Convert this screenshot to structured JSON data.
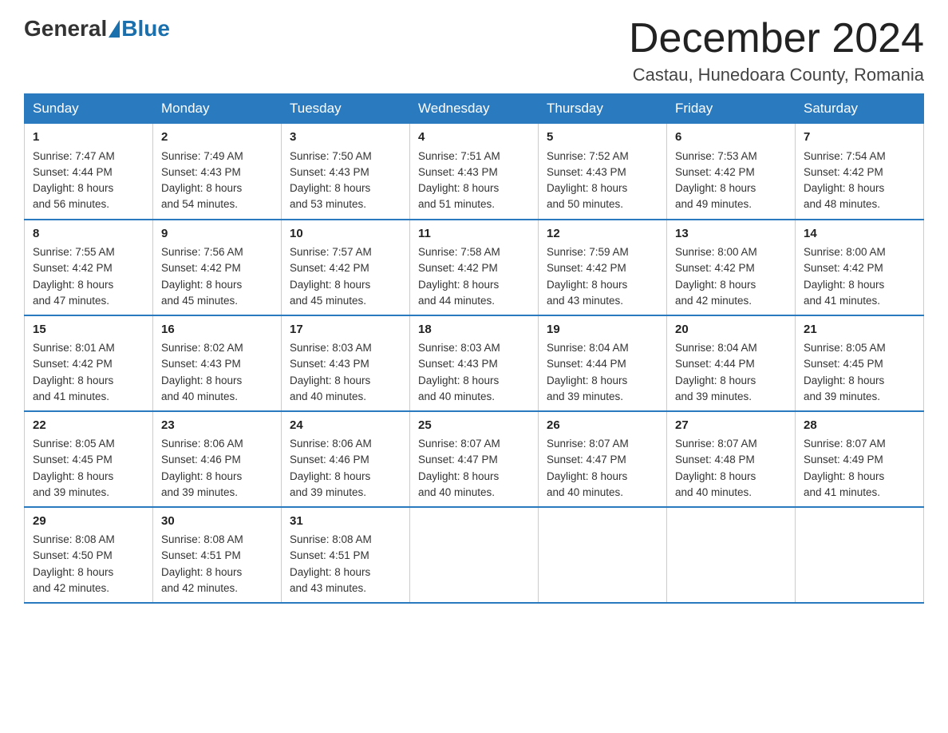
{
  "logo": {
    "general": "General",
    "blue": "Blue"
  },
  "title": "December 2024",
  "location": "Castau, Hunedoara County, Romania",
  "weekdays": [
    "Sunday",
    "Monday",
    "Tuesday",
    "Wednesday",
    "Thursday",
    "Friday",
    "Saturday"
  ],
  "weeks": [
    [
      {
        "day": "1",
        "sunrise": "7:47 AM",
        "sunset": "4:44 PM",
        "daylight": "8 hours and 56 minutes."
      },
      {
        "day": "2",
        "sunrise": "7:49 AM",
        "sunset": "4:43 PM",
        "daylight": "8 hours and 54 minutes."
      },
      {
        "day": "3",
        "sunrise": "7:50 AM",
        "sunset": "4:43 PM",
        "daylight": "8 hours and 53 minutes."
      },
      {
        "day": "4",
        "sunrise": "7:51 AM",
        "sunset": "4:43 PM",
        "daylight": "8 hours and 51 minutes."
      },
      {
        "day": "5",
        "sunrise": "7:52 AM",
        "sunset": "4:43 PM",
        "daylight": "8 hours and 50 minutes."
      },
      {
        "day": "6",
        "sunrise": "7:53 AM",
        "sunset": "4:42 PM",
        "daylight": "8 hours and 49 minutes."
      },
      {
        "day": "7",
        "sunrise": "7:54 AM",
        "sunset": "4:42 PM",
        "daylight": "8 hours and 48 minutes."
      }
    ],
    [
      {
        "day": "8",
        "sunrise": "7:55 AM",
        "sunset": "4:42 PM",
        "daylight": "8 hours and 47 minutes."
      },
      {
        "day": "9",
        "sunrise": "7:56 AM",
        "sunset": "4:42 PM",
        "daylight": "8 hours and 45 minutes."
      },
      {
        "day": "10",
        "sunrise": "7:57 AM",
        "sunset": "4:42 PM",
        "daylight": "8 hours and 45 minutes."
      },
      {
        "day": "11",
        "sunrise": "7:58 AM",
        "sunset": "4:42 PM",
        "daylight": "8 hours and 44 minutes."
      },
      {
        "day": "12",
        "sunrise": "7:59 AM",
        "sunset": "4:42 PM",
        "daylight": "8 hours and 43 minutes."
      },
      {
        "day": "13",
        "sunrise": "8:00 AM",
        "sunset": "4:42 PM",
        "daylight": "8 hours and 42 minutes."
      },
      {
        "day": "14",
        "sunrise": "8:00 AM",
        "sunset": "4:42 PM",
        "daylight": "8 hours and 41 minutes."
      }
    ],
    [
      {
        "day": "15",
        "sunrise": "8:01 AM",
        "sunset": "4:42 PM",
        "daylight": "8 hours and 41 minutes."
      },
      {
        "day": "16",
        "sunrise": "8:02 AM",
        "sunset": "4:43 PM",
        "daylight": "8 hours and 40 minutes."
      },
      {
        "day": "17",
        "sunrise": "8:03 AM",
        "sunset": "4:43 PM",
        "daylight": "8 hours and 40 minutes."
      },
      {
        "day": "18",
        "sunrise": "8:03 AM",
        "sunset": "4:43 PM",
        "daylight": "8 hours and 40 minutes."
      },
      {
        "day": "19",
        "sunrise": "8:04 AM",
        "sunset": "4:44 PM",
        "daylight": "8 hours and 39 minutes."
      },
      {
        "day": "20",
        "sunrise": "8:04 AM",
        "sunset": "4:44 PM",
        "daylight": "8 hours and 39 minutes."
      },
      {
        "day": "21",
        "sunrise": "8:05 AM",
        "sunset": "4:45 PM",
        "daylight": "8 hours and 39 minutes."
      }
    ],
    [
      {
        "day": "22",
        "sunrise": "8:05 AM",
        "sunset": "4:45 PM",
        "daylight": "8 hours and 39 minutes."
      },
      {
        "day": "23",
        "sunrise": "8:06 AM",
        "sunset": "4:46 PM",
        "daylight": "8 hours and 39 minutes."
      },
      {
        "day": "24",
        "sunrise": "8:06 AM",
        "sunset": "4:46 PM",
        "daylight": "8 hours and 39 minutes."
      },
      {
        "day": "25",
        "sunrise": "8:07 AM",
        "sunset": "4:47 PM",
        "daylight": "8 hours and 40 minutes."
      },
      {
        "day": "26",
        "sunrise": "8:07 AM",
        "sunset": "4:47 PM",
        "daylight": "8 hours and 40 minutes."
      },
      {
        "day": "27",
        "sunrise": "8:07 AM",
        "sunset": "4:48 PM",
        "daylight": "8 hours and 40 minutes."
      },
      {
        "day": "28",
        "sunrise": "8:07 AM",
        "sunset": "4:49 PM",
        "daylight": "8 hours and 41 minutes."
      }
    ],
    [
      {
        "day": "29",
        "sunrise": "8:08 AM",
        "sunset": "4:50 PM",
        "daylight": "8 hours and 42 minutes."
      },
      {
        "day": "30",
        "sunrise": "8:08 AM",
        "sunset": "4:51 PM",
        "daylight": "8 hours and 42 minutes."
      },
      {
        "day": "31",
        "sunrise": "8:08 AM",
        "sunset": "4:51 PM",
        "daylight": "8 hours and 43 minutes."
      },
      null,
      null,
      null,
      null
    ]
  ],
  "labels": {
    "sunrise": "Sunrise:",
    "sunset": "Sunset:",
    "daylight": "Daylight:"
  }
}
